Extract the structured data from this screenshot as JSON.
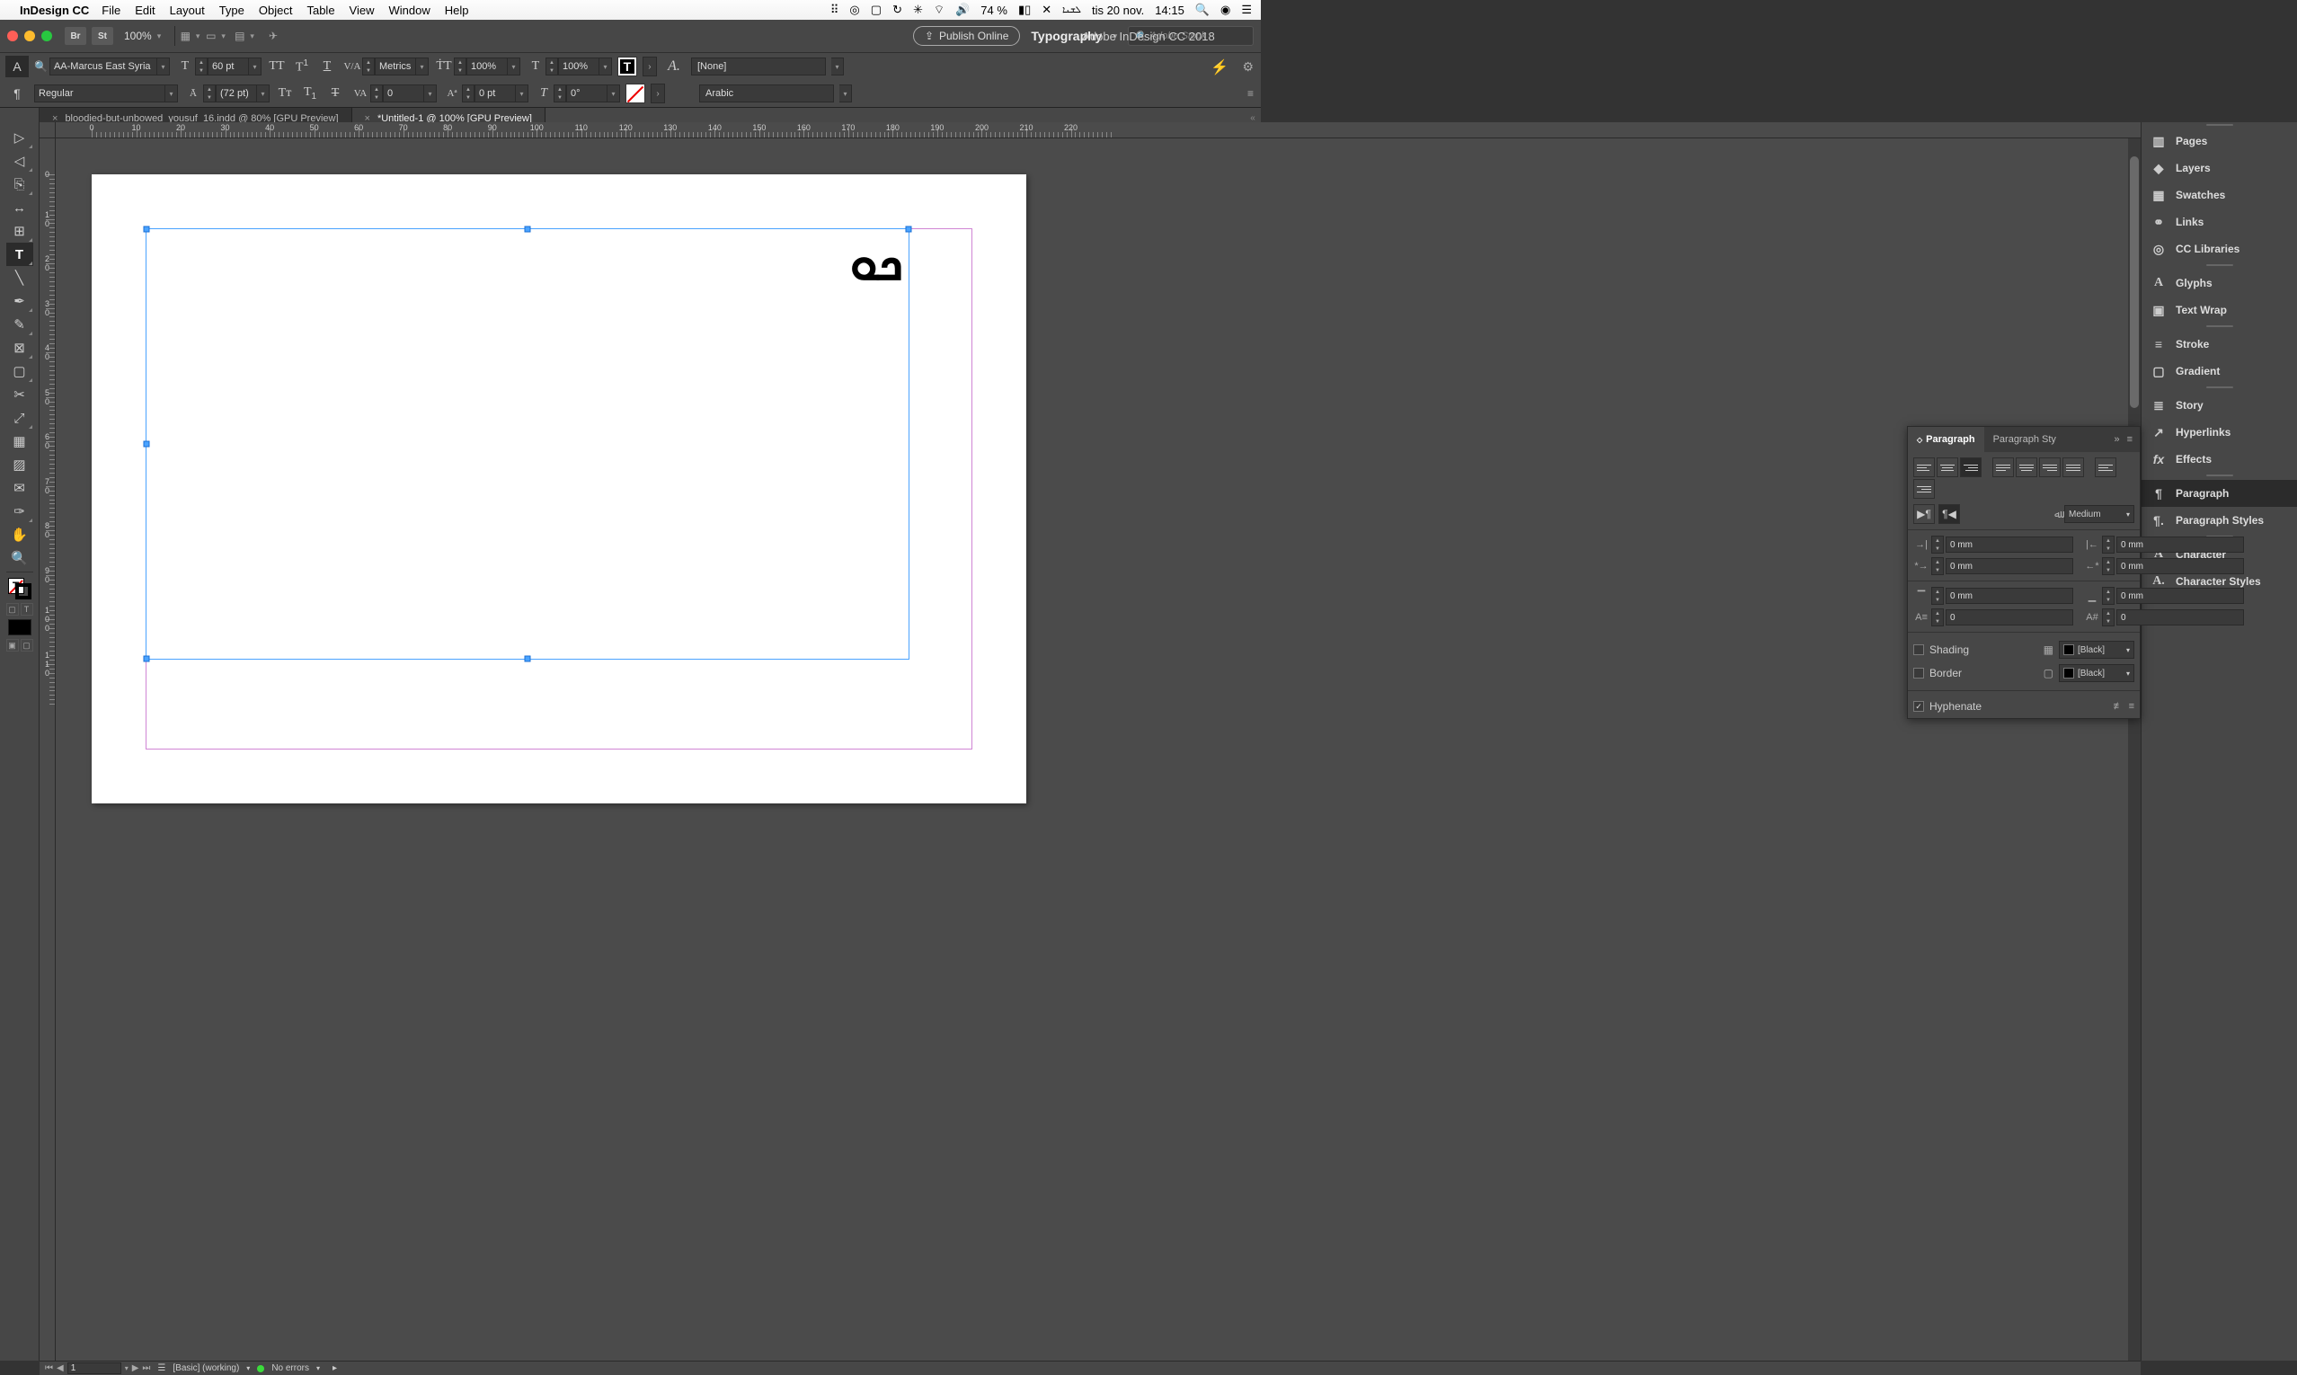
{
  "menubar": {
    "app": "InDesign CC",
    "items": [
      "File",
      "Edit",
      "Layout",
      "Type",
      "Object",
      "Table",
      "View",
      "Window",
      "Help"
    ],
    "battery": "74 %",
    "date": "tis 20 nov.",
    "time": "14:15"
  },
  "appbar": {
    "br": "Br",
    "st": "St",
    "zoom": "100%",
    "title": "Adobe InDesign CC 2018",
    "publish": "Publish Online",
    "workspace": "Typography",
    "search_placeholder": "Adobe Stock"
  },
  "ctrls": {
    "font": "AA-Marcus East Syria",
    "font_size": "60 pt",
    "kerning": "Metrics",
    "hscale": "100%",
    "vscale": "100%",
    "charstyle": "[None]",
    "style": "Regular",
    "leading": "(72 pt)",
    "tracking": "0",
    "baseline": "0 pt",
    "skew": "0°",
    "lang": "Arabic"
  },
  "tabs": [
    {
      "label": "bloodied-but-unbowed_yousuf_16.indd @ 80% [GPU Preview]",
      "active": false
    },
    {
      "label": "*Untitled-1 @ 100% [GPU Preview]",
      "active": true
    }
  ],
  "hruler": [
    0,
    10,
    20,
    30,
    40,
    50,
    60,
    70,
    80,
    90,
    100,
    110,
    120,
    130,
    140,
    150,
    160,
    170,
    180,
    190,
    200,
    210,
    220
  ],
  "vruler": [
    0,
    10,
    20,
    30,
    40,
    50,
    60,
    70,
    80,
    90,
    100,
    110
  ],
  "sample_text": "ܟܘ",
  "paragraph_panel": {
    "tab1": "Paragraph",
    "tab2": "Paragraph Sty",
    "kashida": "Medium",
    "indent_left": "0 mm",
    "indent_right": "0 mm",
    "first_line": "0 mm",
    "last_line": "0 mm",
    "space_before": "0 mm",
    "space_after": "0 mm",
    "dropcap_lines": "0",
    "dropcap_chars": "0",
    "shading_label": "Shading",
    "shading_color": "[Black]",
    "border_label": "Border",
    "border_color": "[Black]",
    "hyphenate": "Hyphenate"
  },
  "right_panels": {
    "pages": "Pages",
    "layers": "Layers",
    "swatches": "Swatches",
    "links": "Links",
    "cc": "CC Libraries",
    "glyphs": "Glyphs",
    "textwrap": "Text Wrap",
    "stroke": "Stroke",
    "gradient": "Gradient",
    "story": "Story",
    "hyperlinks": "Hyperlinks",
    "effects": "Effects",
    "paragraph": "Paragraph",
    "pstyles": "Paragraph Styles",
    "character": "Character",
    "cstyles": "Character Styles"
  },
  "status": {
    "page": "1",
    "preflight_profile": "[Basic] (working)",
    "errors": "No errors"
  }
}
